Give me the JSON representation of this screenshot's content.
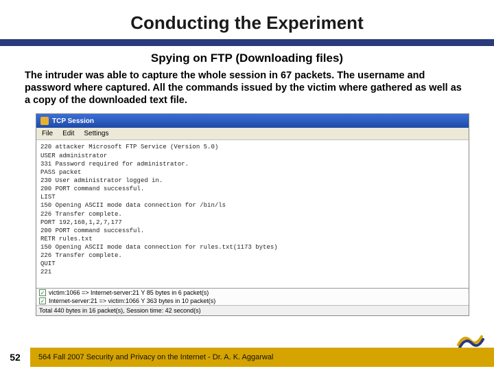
{
  "title": "Conducting the Experiment",
  "subtitle": "Spying on FTP (Downloading files)",
  "body": "The intruder was able to capture the whole session in 67 packets. The username and password where captured. All the commands issued by the victim where gathered as well as a copy of the downloaded text file.",
  "window": {
    "title": "TCP Session",
    "menus": [
      "File",
      "Edit",
      "Settings"
    ],
    "lines": [
      "220 attacker Microsoft FTP Service (Version 5.0)",
      "USER administrator",
      "331 Password required for administrator.",
      "PASS packet",
      "230 User administrator logged in.",
      "200 PORT command successful.",
      "LIST",
      "150 Opening ASCII mode data connection for /bin/ls",
      "226 Transfer complete.",
      "PORT 192,168,1,2,7,177",
      "200 PORT command successful.",
      "RETR rules.txt",
      "150 Opening ASCII mode data connection for rules.txt(1173 bytes)",
      "226 Transfer complete.",
      "QUIT",
      "221"
    ],
    "summary": [
      "victim:1066 => Internet-server:21  Y 85 bytes in 6 packet(s)",
      "Internet-server:21 => victim:1066  Y 363 bytes in 10 packet(s)"
    ],
    "status": "Total 440 bytes in 16 packet(s), Session time: 42 second(s)"
  },
  "footer": {
    "page": "52",
    "text": "564  Fall 2007 Security and Privacy on the Internet - Dr. A. K. Aggarwal"
  }
}
